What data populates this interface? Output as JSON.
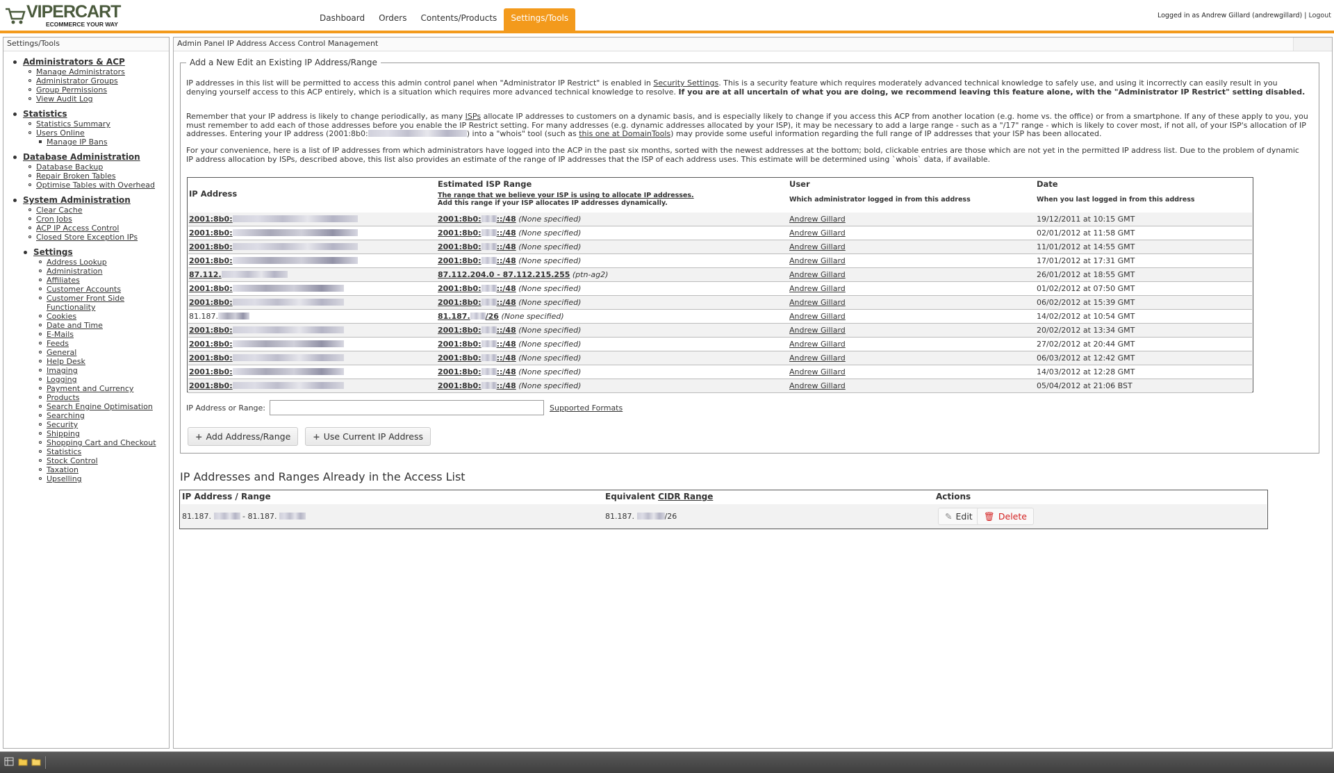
{
  "header": {
    "logo_text": "VIPERCART",
    "logo_tagline": "ECOMMERCE YOUR WAY",
    "nav": [
      "Dashboard",
      "Orders",
      "Contents/Products",
      "Settings/Tools"
    ],
    "active_nav": "Settings/Tools",
    "user_text": "Logged in as Andrew Gillard (andrewgillard)",
    "logout_label": "Logout",
    "accent_color": "#f39a1c"
  },
  "sidebar": {
    "title": "Settings/Tools",
    "groups": [
      {
        "heading": "Administrators & ACP",
        "items": [
          "Manage Administrators",
          "Administrator Groups",
          "Group Permissions",
          "View Audit Log"
        ]
      },
      {
        "heading": "Statistics",
        "items": [
          "Statistics Summary",
          "Users Online"
        ],
        "subitems": [
          "Manage IP Bans"
        ]
      },
      {
        "heading": "Database Administration",
        "items": [
          "Database Backup",
          "Repair Broken Tables",
          "Optimise Tables with Overhead"
        ]
      },
      {
        "heading": "System Administration",
        "items": [
          "Clear Cache",
          "Cron Jobs",
          "ACP IP Access Control",
          "Closed Store Exception IPs"
        ]
      },
      {
        "heading": "Settings",
        "items": [
          "Address Lookup",
          "Administration",
          "Affiliates",
          "Customer Accounts",
          "Customer Front Side Functionality",
          "Cookies",
          "Date and Time",
          "E-Mails",
          "Feeds",
          "General",
          "Help Desk",
          "Imaging",
          "Logging",
          "Payment and Currency",
          "Products",
          "Search Engine Optimisation",
          "Searching",
          "Security",
          "Shipping",
          "Shopping Cart and Checkout",
          "Statistics",
          "Stock Control",
          "Taxation",
          "Upselling"
        ]
      }
    ]
  },
  "main": {
    "title": "Admin Panel IP Address Access Control Management",
    "legend": "Add a New Edit an Existing IP Address/Range",
    "p1_a": "IP addresses in this list will be permitted to access this admin control panel when \"Administrator IP Restrict\" is enabled in ",
    "p1_link": "Security Settings",
    "p1_b": ". This is a security feature which requires moderately advanced technical knowledge to safely use, and using it incorrectly can easily result in you denying yourself access to this ACP entirely, which is a situation which requires more advanced technical knowledge to resolve. ",
    "p1_bold": "If you are at all uncertain of what you are doing, we recommend leaving this feature alone, with the \"Administrator IP Restrict\" setting disabled.",
    "p2_a": "Remember that your IP address is likely to change periodically, as many ",
    "p2_link": "ISPs",
    "p2_b": " allocate IP addresses to customers on a dynamic basis, and is especially likely to change if you access this ACP from another location (e.g. home vs. the office) or from a smartphone. If any of these apply to you, you must remember to add each of those addresses before you enable the IP Restrict setting. For many addresses (e.g. dynamic addresses allocated by your ISP), it may be necessary to add a large range - such as a \"/17\" range - which is likely to cover most, if not all, of your ISP's allocation of IP addresses. Entering your IP address (2001:8b0:",
    "p2_c": ") into a \"whois\" tool (such as ",
    "p2_link2": "this one at DomainTools",
    "p2_d": ") may provide some useful information regarding the full range of IP addresses that your ISP has been allocated.",
    "p3": "For your convenience, here is a list of IP addresses from which administrators have logged into the ACP in the past six months, sorted with the newest addresses at the bottom; bold, clickable entries are those which are not yet in the permitted IP address list. Due to the problem of dynamic IP address allocation by ISPs, described above, this list also provides an estimate of the range of IP addresses that the ISP of each address uses. This estimate will be determined using `whois` data, if available.",
    "table": {
      "col_ip": "IP Address",
      "col_range": "Estimated ISP Range",
      "col_range_sub1": "The range that we believe your ISP is using to allocate IP addresses.",
      "col_range_sub2": "Add this range if your ISP allocates IP addresses dynamically.",
      "col_user": "User",
      "col_user_sub": "Which administrator logged in from this address",
      "col_date": "Date",
      "col_date_sub": "When you last logged in from this address",
      "rows": [
        {
          "ip": "2001:8b0:",
          "bold": true,
          "range_a": "2001:8b0:",
          "range_b": "::/48",
          "note": "(None specified)",
          "user": "Andrew Gillard",
          "date": "19/12/2011 at 10:15 GMT"
        },
        {
          "ip": "2001:8b0:",
          "bold": true,
          "range_a": "2001:8b0:",
          "range_b": "::/48",
          "note": "(None specified)",
          "user": "Andrew Gillard",
          "date": "02/01/2012 at 11:58 GMT"
        },
        {
          "ip": "2001:8b0:",
          "bold": true,
          "range_a": "2001:8b0:",
          "range_b": "::/48",
          "note": "(None specified)",
          "user": "Andrew Gillard",
          "date": "11/01/2012 at 14:55 GMT"
        },
        {
          "ip": "2001:8b0:",
          "bold": true,
          "range_a": "2001:8b0:",
          "range_b": "::/48",
          "note": "(None specified)",
          "user": "Andrew Gillard",
          "date": "17/01/2012 at 17:31 GMT"
        },
        {
          "ip": "87.112.",
          "bold": true,
          "range_a": "87.112.204.0 - 87.112.215.255",
          "range_b": "",
          "note": "(ptn-ag2)",
          "user": "Andrew Gillard",
          "date": "26/01/2012 at 18:55 GMT"
        },
        {
          "ip": "2001:8b0:",
          "bold": true,
          "range_a": "2001:8b0:",
          "range_b": "::/48",
          "note": "(None specified)",
          "user": "Andrew Gillard",
          "date": "01/02/2012 at 07:50 GMT"
        },
        {
          "ip": "2001:8b0:",
          "bold": true,
          "range_a": "2001:8b0:",
          "range_b": "::/48",
          "note": "(None specified)",
          "user": "Andrew Gillard",
          "date": "06/02/2012 at 15:39 GMT"
        },
        {
          "ip": "81.187.",
          "bold": false,
          "range_a": "81.187.",
          "range_b": "/26",
          "note": "(None specified)",
          "user": "Andrew Gillard",
          "date": "14/02/2012 at 10:54 GMT"
        },
        {
          "ip": "2001:8b0:",
          "bold": true,
          "range_a": "2001:8b0:",
          "range_b": "::/48",
          "note": "(None specified)",
          "user": "Andrew Gillard",
          "date": "20/02/2012 at 13:34 GMT"
        },
        {
          "ip": "2001:8b0:",
          "bold": true,
          "range_a": "2001:8b0:",
          "range_b": "::/48",
          "note": "(None specified)",
          "user": "Andrew Gillard",
          "date": "27/02/2012 at 20:44 GMT"
        },
        {
          "ip": "2001:8b0:",
          "bold": true,
          "range_a": "2001:8b0:",
          "range_b": "::/48",
          "note": "(None specified)",
          "user": "Andrew Gillard",
          "date": "06/03/2012 at 12:42 GMT"
        },
        {
          "ip": "2001:8b0:",
          "bold": true,
          "range_a": "2001:8b0:",
          "range_b": "::/48",
          "note": "(None specified)",
          "user": "Andrew Gillard",
          "date": "14/03/2012 at 12:28 GMT"
        },
        {
          "ip": "2001:8b0:",
          "bold": true,
          "range_a": "2001:8b0:",
          "range_b": "::/48",
          "note": "(None specified)",
          "user": "Andrew Gillard",
          "date": "05/04/2012 at 21:06 BST"
        }
      ]
    },
    "ip_label": "IP Address or Range:",
    "ip_value": "",
    "supported_formats": "Supported Formats",
    "btn_add": "Add Address/Range",
    "btn_use_current": "Use Current IP Address",
    "h2": "IP Addresses and Ranges Already in the Access List",
    "acl": {
      "col_ip": "IP Address / Range",
      "col_cidr_a": "Equivalent ",
      "col_cidr_link": "CIDR Range",
      "col_actions": "Actions",
      "row": {
        "ip_a": "81.187.",
        "ip_b": "- 81.187.",
        "cidr_a": "81.187.",
        "cidr_b": "/26",
        "edit": "Edit",
        "delete": "Delete"
      }
    }
  }
}
